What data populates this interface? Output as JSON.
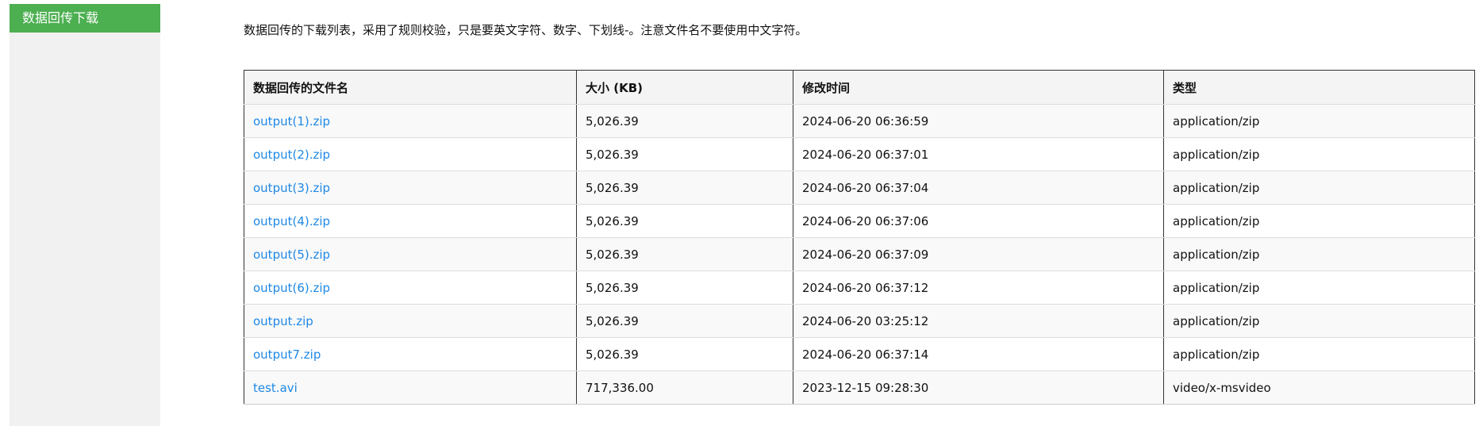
{
  "sidebar": {
    "items": [
      {
        "label": "数据回传下载",
        "active": true
      }
    ]
  },
  "intro": {
    "text": "数据回传的下载列表，采用了规则校验，只是要英文字符、数字、下划线-。注意文件名不要使用中文字符。"
  },
  "table": {
    "columns": [
      "数据回传的文件名",
      "大小 (KB)",
      "修改时间",
      "类型"
    ],
    "rows": [
      {
        "name": "output(1).zip",
        "size": "5,026.39",
        "modified": "2024-06-20 06:36:59",
        "type": "application/zip"
      },
      {
        "name": "output(2).zip",
        "size": "5,026.39",
        "modified": "2024-06-20 06:37:01",
        "type": "application/zip"
      },
      {
        "name": "output(3).zip",
        "size": "5,026.39",
        "modified": "2024-06-20 06:37:04",
        "type": "application/zip"
      },
      {
        "name": "output(4).zip",
        "size": "5,026.39",
        "modified": "2024-06-20 06:37:06",
        "type": "application/zip"
      },
      {
        "name": "output(5).zip",
        "size": "5,026.39",
        "modified": "2024-06-20 06:37:09",
        "type": "application/zip"
      },
      {
        "name": "output(6).zip",
        "size": "5,026.39",
        "modified": "2024-06-20 06:37:12",
        "type": "application/zip"
      },
      {
        "name": "output.zip",
        "size": "5,026.39",
        "modified": "2024-06-20 03:25:12",
        "type": "application/zip"
      },
      {
        "name": "output7.zip",
        "size": "5,026.39",
        "modified": "2024-06-20 06:37:14",
        "type": "application/zip"
      },
      {
        "name": "test.avi",
        "size": "717,336.00",
        "modified": "2023-12-15 09:28:30",
        "type": "video/x-msvideo"
      }
    ]
  },
  "colors": {
    "accent": "#4caf50",
    "link": "#1e88e5",
    "sidebar_bg": "#f1f1f1"
  }
}
